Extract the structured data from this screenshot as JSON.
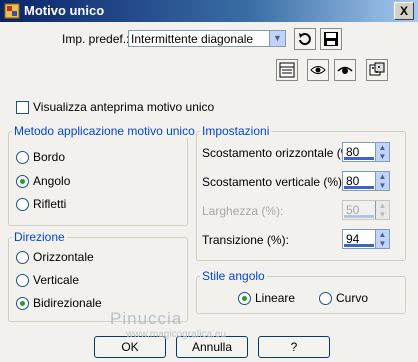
{
  "window": {
    "title": "Motivo unico",
    "close_symbol": "X"
  },
  "preset": {
    "label": "Imp. predef.:",
    "value": "Intermittente diagonale"
  },
  "toolbar": {
    "icons": [
      "save-preset-icon",
      "reset-icon",
      "grid-icon",
      "eye-icon",
      "eye-right-icon",
      "dice-icon"
    ]
  },
  "preview_checkbox": {
    "label": "Visualizza anteprima motivo unico",
    "checked": false
  },
  "metodo": {
    "legend": "Metodo applicazione motivo unico",
    "options": [
      "Bordo",
      "Angolo",
      "Rifletti"
    ],
    "selected": "Angolo"
  },
  "direzione": {
    "legend": "Direzione",
    "options": [
      "Orizzontale",
      "Verticale",
      "Bidirezionale"
    ],
    "selected": "Bidirezionale"
  },
  "impostazioni": {
    "legend": "Impostazioni",
    "fields": [
      {
        "label": "Scostamento orizzontale (%):",
        "value": "80",
        "enabled": true
      },
      {
        "label": "Scostamento verticale (%):",
        "value": "80",
        "enabled": true
      },
      {
        "label": "Larghezza (%):",
        "value": "50",
        "enabled": false
      },
      {
        "label": "Transizione (%):",
        "value": "94",
        "enabled": true
      }
    ]
  },
  "stile": {
    "legend": "Stile angolo",
    "options": [
      "Lineare",
      "Curvo"
    ],
    "selected": "Lineare"
  },
  "buttons": {
    "ok": "OK",
    "cancel": "Annulla",
    "help": "?"
  },
  "watermark": {
    "line1": "Pinuccia",
    "line2": "www.magicografica.eu"
  },
  "colors": {
    "title_start": "#0a246a",
    "accent_green": "#21a121",
    "legend_blue": "#0046d5"
  }
}
